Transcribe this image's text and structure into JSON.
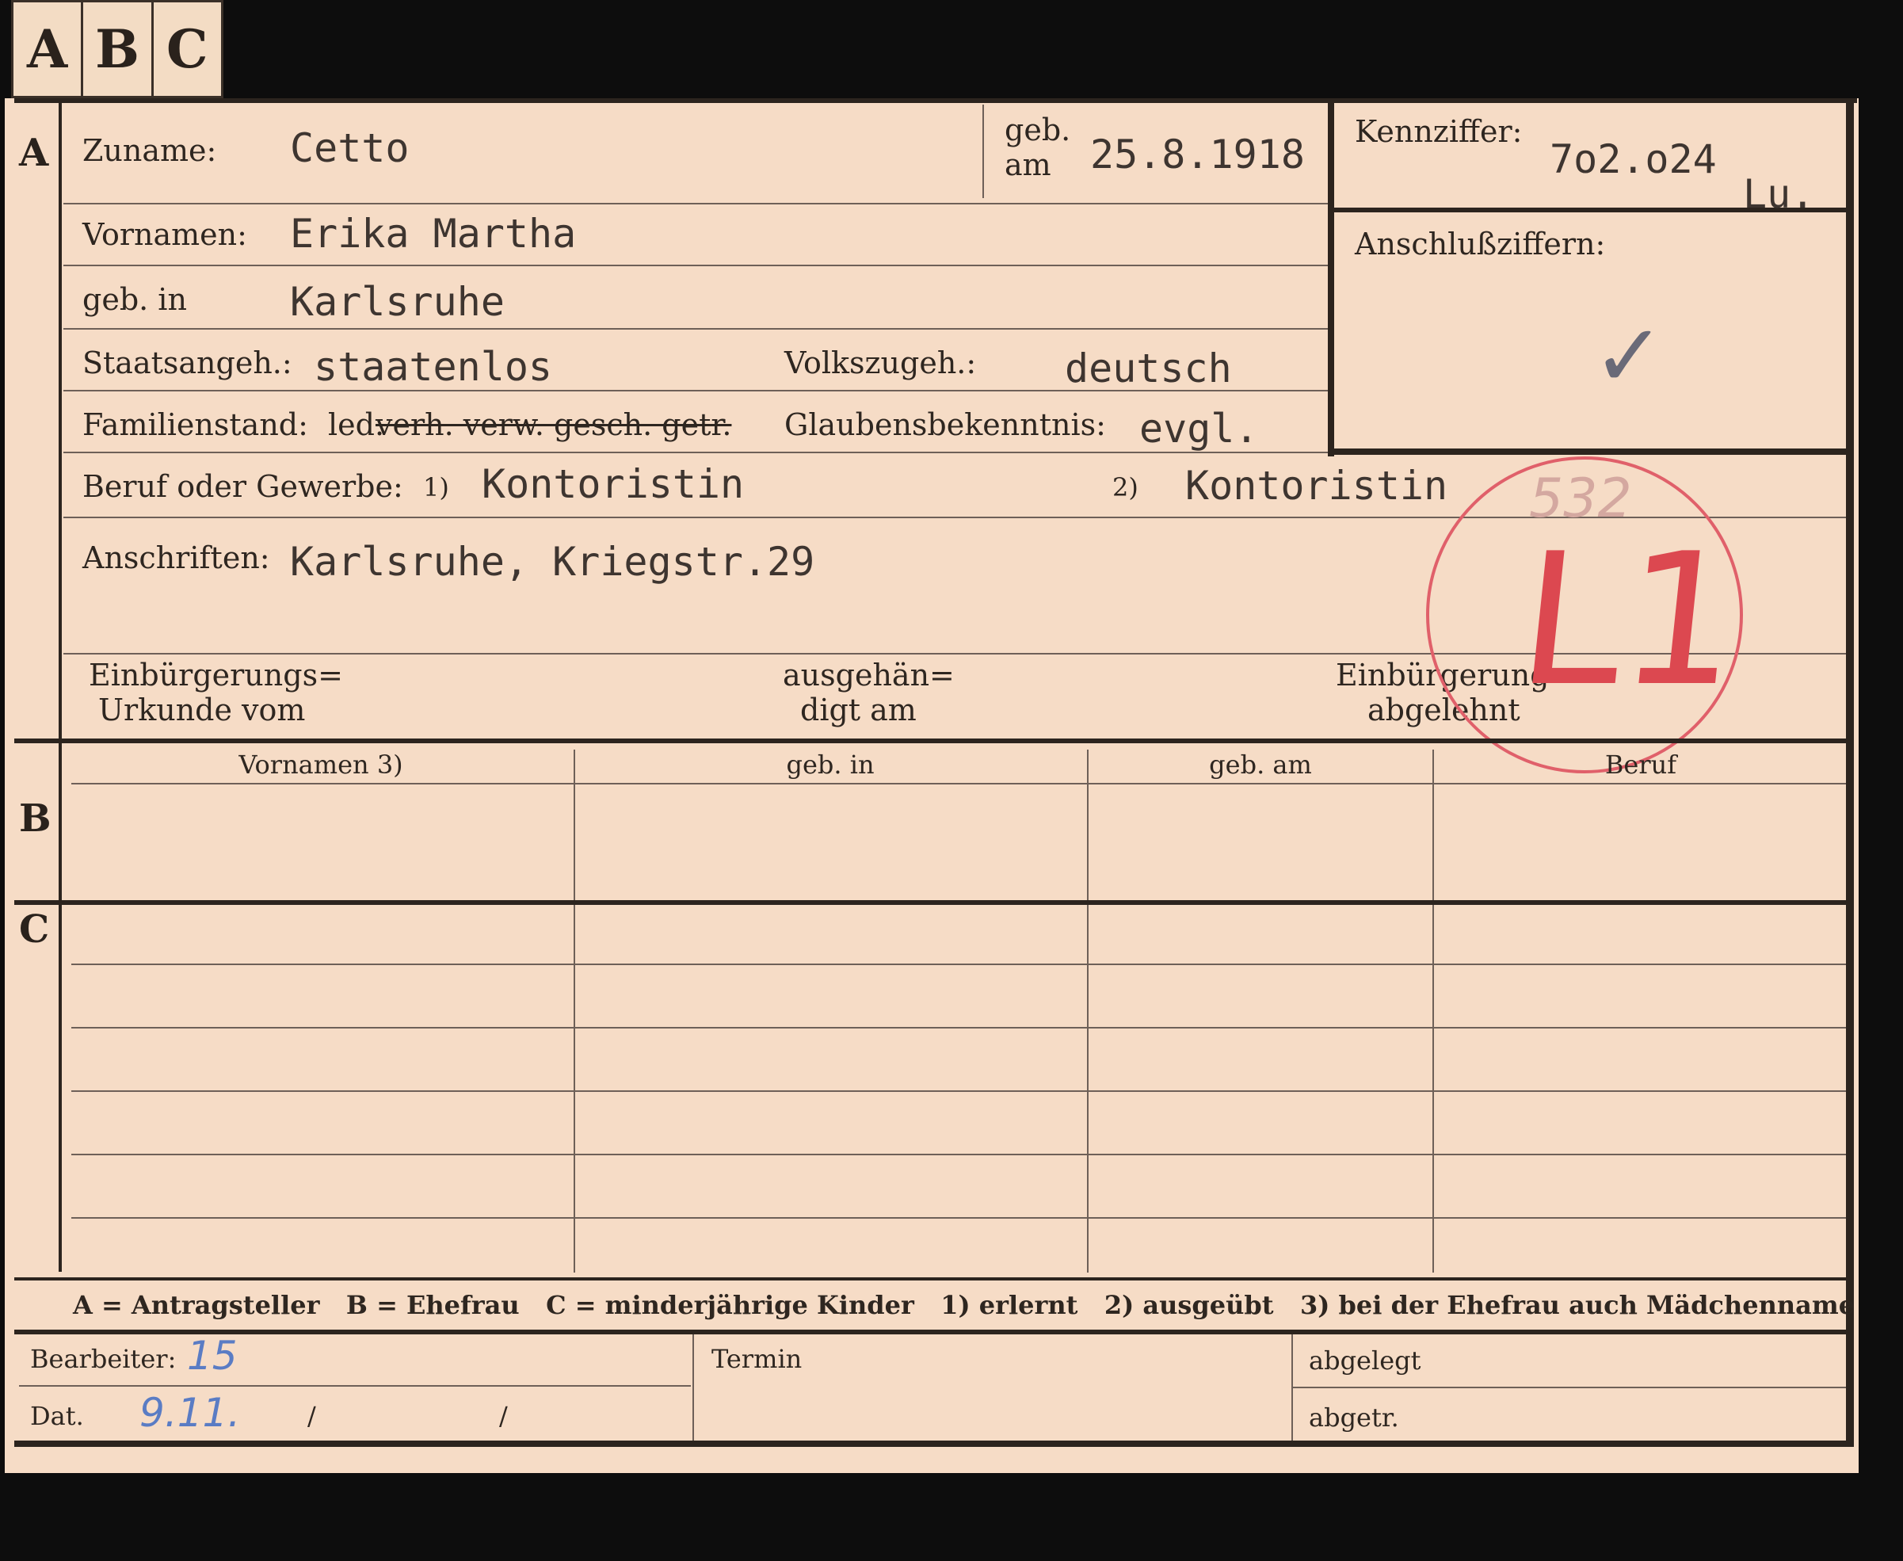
{
  "tabs": [
    "A",
    "B",
    "C"
  ],
  "sections": {
    "a": "A",
    "b": "B",
    "c": "C"
  },
  "fields": {
    "zuname_label": "Zuname:",
    "zuname_value": "Cetto",
    "geb_am_label_1": "geb.",
    "geb_am_label_2": "am",
    "geb_am_value": "25.8.1918",
    "kennziffer_label": "Kennziffer:",
    "kennziffer_value": "7o2.o24",
    "kennziffer_suffix": "Lu.",
    "anschlussziffern_label": "Anschlußziffern:",
    "vornamen_label": "Vornamen:",
    "vornamen_value": "Erika Martha",
    "geb_in_label": "geb. in",
    "geb_in_value": "Karlsruhe",
    "staatsangeh_label": "Staatsangeh.:",
    "staatsangeh_value": "staatenlos",
    "volkszugeh_label": "Volkszugeh.:",
    "volkszugeh_value": "deutsch",
    "familienstand_label": "Familienstand:",
    "familienstand_led": "led.",
    "familienstand_struck": "verh. verw. gesch. getr.",
    "glaubensbekenntnis_label": "Glaubensbekenntnis:",
    "glaubensbekenntnis_value": "evgl.",
    "beruf_label": "Beruf oder Gewerbe:",
    "beruf_mark_1": "1)",
    "beruf_value_1": "Kontoristin",
    "beruf_mark_2": "2)",
    "beruf_value_2": "Kontoristin",
    "anschriften_label": "Anschriften:",
    "anschriften_value": "Karlsruhe, Kriegstr.29",
    "einbuergerung_urkunde_1": "Einbürgerungs=",
    "einbuergerung_urkunde_2": "Urkunde vom",
    "ausgehaendigt_1": "ausgehän=",
    "ausgehaendigt_2": "digt am",
    "einbuergerung_abgelehnt_1": "Einbürgerung",
    "einbuergerung_abgelehnt_2": "abgelehnt"
  },
  "stamp": {
    "number": "532",
    "code": "L1"
  },
  "table_headers": [
    "Vornamen 3)",
    "geb. in",
    "geb. am",
    "Beruf"
  ],
  "legend": "A = Antragsteller   B = Ehefrau   C = minderjährige Kinder   1) erlernt   2) ausgeübt   3) bei der Ehefrau auch Mädchenname",
  "footer": {
    "bearbeiter_label": "Bearbeiter:",
    "bearbeiter_value": "15",
    "dat_label": "Dat.",
    "dat_value": "9.11.",
    "slash": "/",
    "termin_label": "Termin",
    "abgelegt_label": "abgelegt",
    "abgetr_label": "abgetr."
  }
}
